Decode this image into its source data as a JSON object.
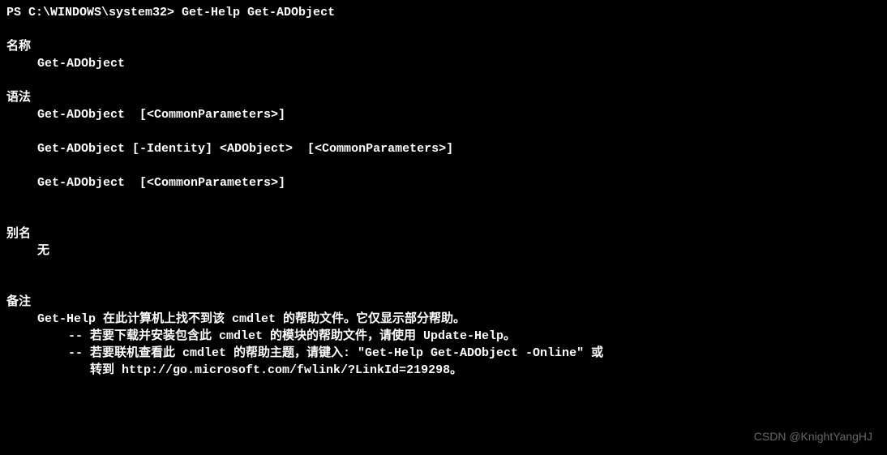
{
  "prompt": "PS C:\\WINDOWS\\system32> Get-Help Get-ADObject",
  "sections": {
    "name": {
      "header": "名称",
      "content": "Get-ADObject"
    },
    "syntax": {
      "header": "语法",
      "lines": [
        "Get-ADObject  [<CommonParameters>]",
        "Get-ADObject [-Identity] <ADObject>  [<CommonParameters>]",
        "Get-ADObject  [<CommonParameters>]"
      ]
    },
    "alias": {
      "header": "别名",
      "content": "无"
    },
    "remarks": {
      "header": "备注",
      "line1": "Get-Help 在此计算机上找不到该 cmdlet 的帮助文件。它仅显示部分帮助。",
      "line2": "-- 若要下载并安装包含此 cmdlet 的模块的帮助文件，请使用 Update-Help。",
      "line3": "-- 若要联机查看此 cmdlet 的帮助主题，请键入: \"Get-Help Get-ADObject -Online\" 或",
      "line4": "   转到 http://go.microsoft.com/fwlink/?LinkId=219298。"
    }
  },
  "watermark": "CSDN @KnightYangHJ"
}
